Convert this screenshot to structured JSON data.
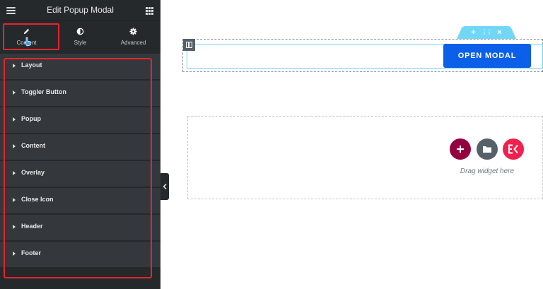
{
  "panel": {
    "title": "Edit Popup Modal",
    "tabs": [
      {
        "label": "Content",
        "icon": "pencil-icon",
        "active": true
      },
      {
        "label": "Style",
        "icon": "half-circle-icon"
      },
      {
        "label": "Advanced",
        "icon": "gear-icon"
      }
    ],
    "sections": [
      {
        "label": "Layout"
      },
      {
        "label": "Toggler Button"
      },
      {
        "label": "Popup"
      },
      {
        "label": "Content"
      },
      {
        "label": "Overlay"
      },
      {
        "label": "Close Icon"
      },
      {
        "label": "Header"
      },
      {
        "label": "Footer"
      }
    ]
  },
  "canvas": {
    "button_label": "OPEN MODAL",
    "toolbar": {
      "add": "+",
      "move": "⋮⋮",
      "close": "×"
    },
    "drop_hint": "Drag widget here"
  },
  "colors": {
    "panel_bg": "#26292c",
    "section_bg": "#34383c",
    "highlight": "#e1262d",
    "button": "#0c5fe8",
    "accent_cyan": "#71d7f7",
    "add_button": "#93003f",
    "template_button": "#556068",
    "elementskit_button": "#f0214d"
  }
}
